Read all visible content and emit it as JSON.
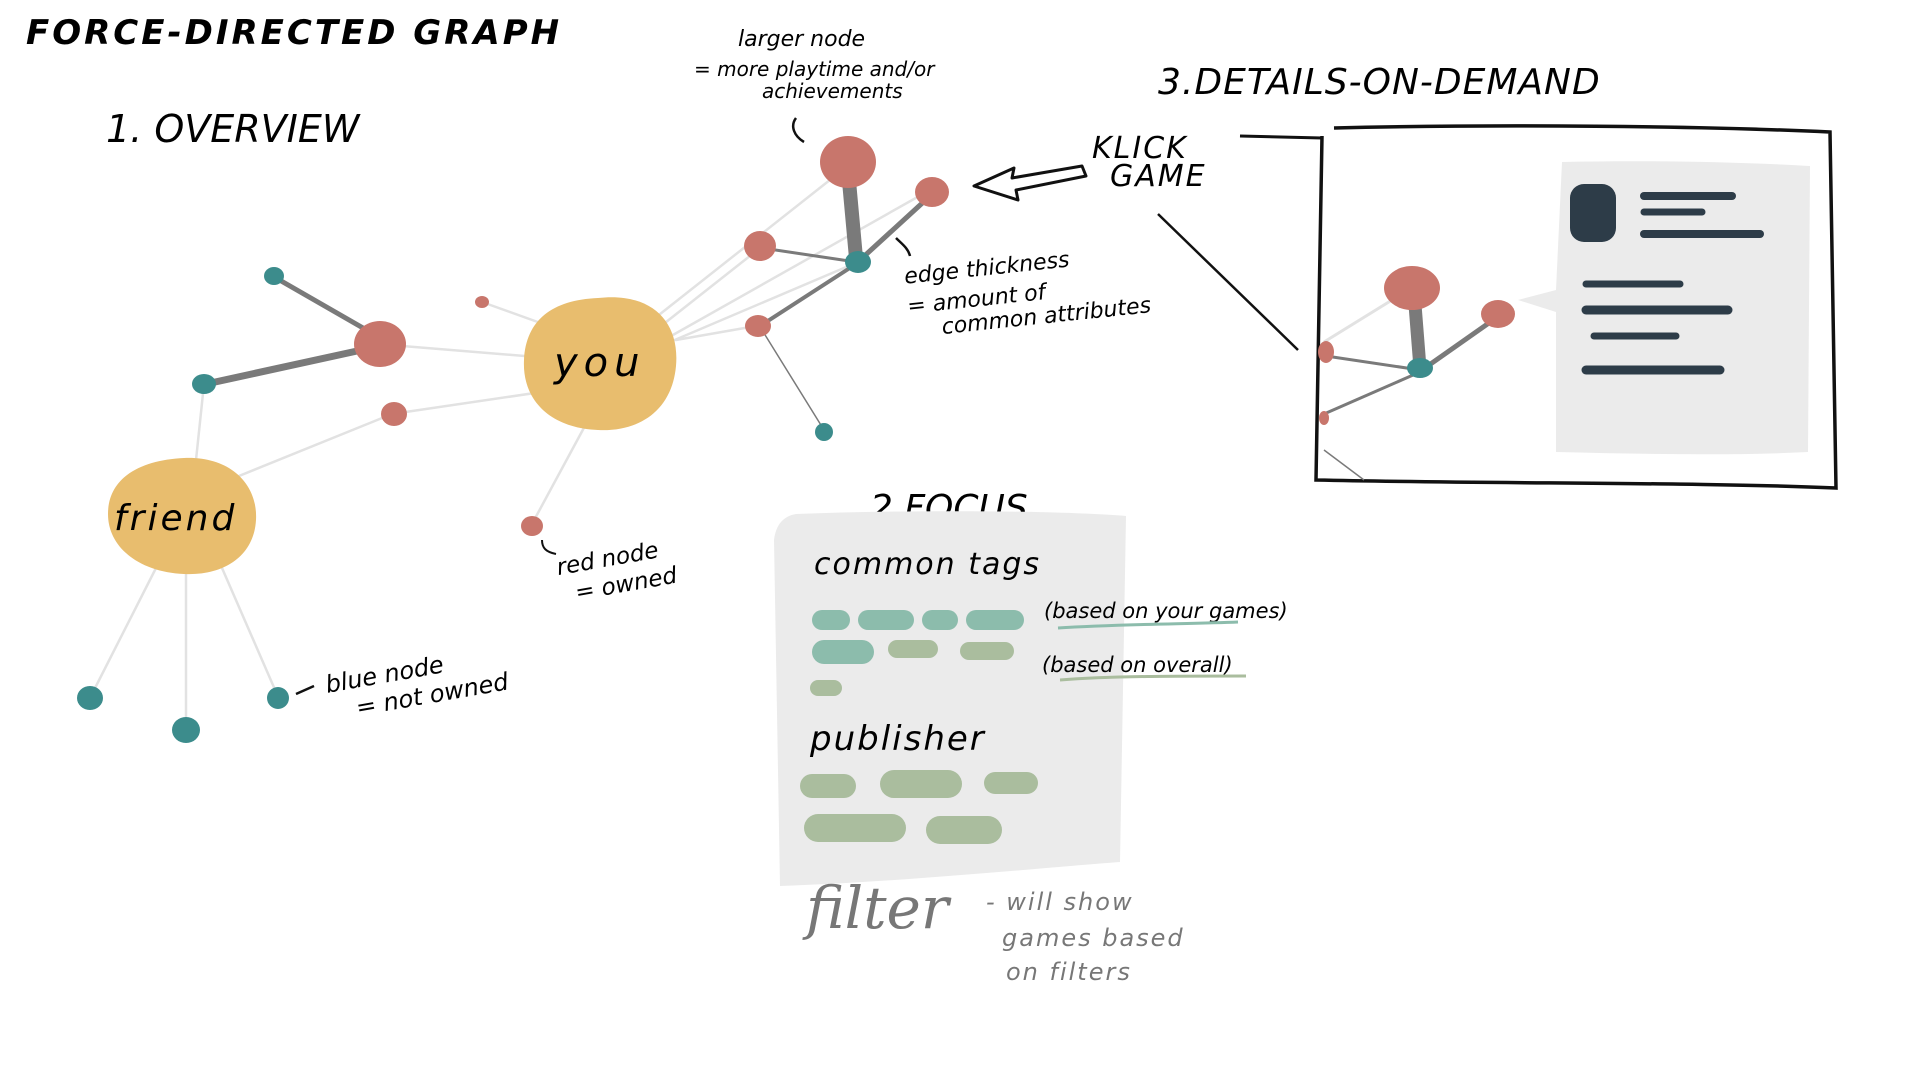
{
  "title": "FORCE-DIRECTED GRAPH",
  "sections": {
    "overview": "1. OVERVIEW",
    "focus": "2.FOCUS",
    "details": "3.DETAILS-ON-DEMAND"
  },
  "nodes": {
    "you": "you",
    "friend": "friend"
  },
  "notes": {
    "larger_node": [
      "larger node",
      "= more playtime and/or",
      "achievements"
    ],
    "edge_thickness": [
      "edge thickness",
      "= amount of",
      "common attributes"
    ],
    "red_node": [
      "red node",
      "= owned"
    ],
    "blue_node": [
      "blue node",
      "= not owned"
    ],
    "click_game": [
      "KLICK",
      "GAME"
    ]
  },
  "focus_panel": {
    "common_tags_heading": "common tags",
    "based_on_your_games": "(based on your games)",
    "based_on_overall": "(based on overall)",
    "publisher_heading": "publisher",
    "filter_label": "filter",
    "filter_note": [
      "- will show",
      "games based",
      "on filters"
    ]
  },
  "colors": {
    "owned": "#c8766c",
    "not_owned": "#3c8c8c",
    "player": "#e8bd6e",
    "edge": "#7a7a7a",
    "edge_light": "#e2e2e2",
    "panel": "#ebebeb",
    "tag_teal": "#8cbcac",
    "tag_green": "#aabd9e",
    "detail_dark": "#2d3c48"
  }
}
